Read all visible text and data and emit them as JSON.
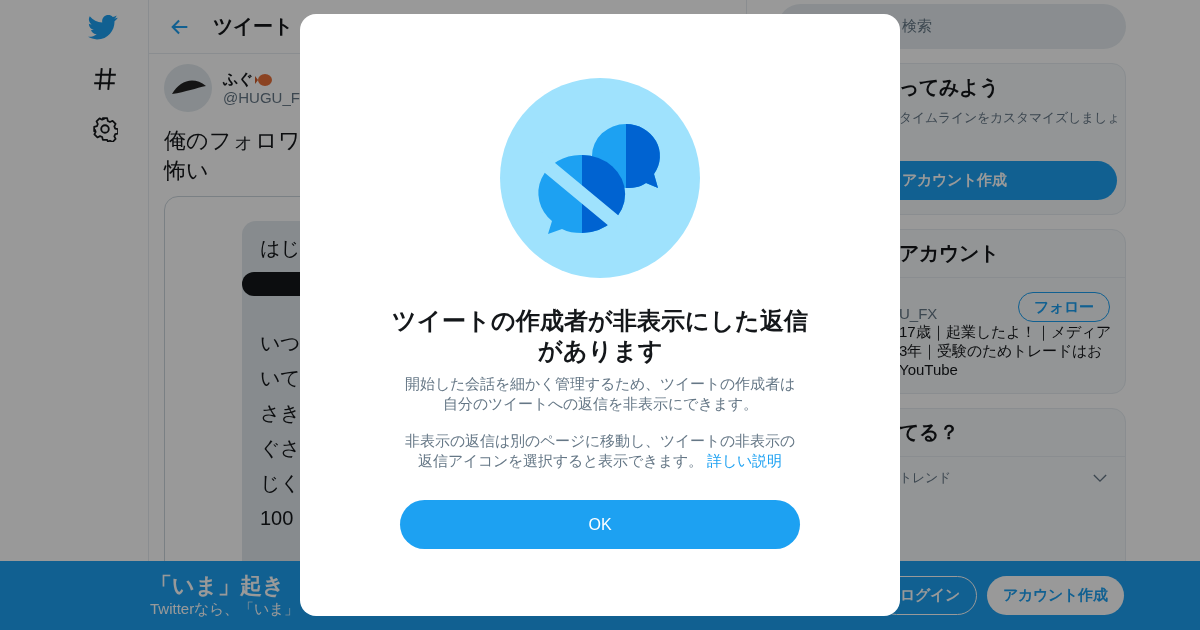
{
  "header": {
    "title": "ツイート"
  },
  "tweet": {
    "name": "ふぐ",
    "handle": "@HUGU_F",
    "text_lines": [
      "俺のフォロワ",
      "怖い"
    ],
    "attachment": {
      "first_line": "はじ",
      "lines": [
        "いつ",
        "いて",
        "さき",
        "ぐさ",
        "じく",
        "100"
      ]
    }
  },
  "sidebar": {
    "search": {
      "placeholder": "検索"
    },
    "signup_card": {
      "title": "ってみよう",
      "text": "タイムラインをカスタマイズしましょ",
      "button": "アカウント作成"
    },
    "accounts_card": {
      "title": "アカウント",
      "handle": "U_FX",
      "follow_button": "フォロー",
      "bio_lines": [
        "17歳｜起業したよ！｜メディア",
        "3年｜受験のためトレードはお",
        "YouTube"
      ]
    },
    "trends_card": {
      "title": "てる？",
      "subtitle": "トレンド"
    }
  },
  "banner": {
    "title": "「いま」起き",
    "subtitle": "Twitterなら、「いま」",
    "buttons": [
      {
        "label": "ログイン",
        "kind": "outline"
      },
      {
        "label": "アカウント作成",
        "kind": "filled"
      }
    ]
  },
  "dialog": {
    "title": "ツイートの作成者が非表示にした返信があります",
    "paragraphs": [
      "開始した会話を細かく管理するため、ツイートの作成者は自分のツイートへの返信を非表示にできます。",
      "非表示の返信は別のページに移動し、ツイートの非表示の返信アイコンを選択すると表示できます。"
    ],
    "link": "詳しい説明",
    "button": "OK"
  }
}
